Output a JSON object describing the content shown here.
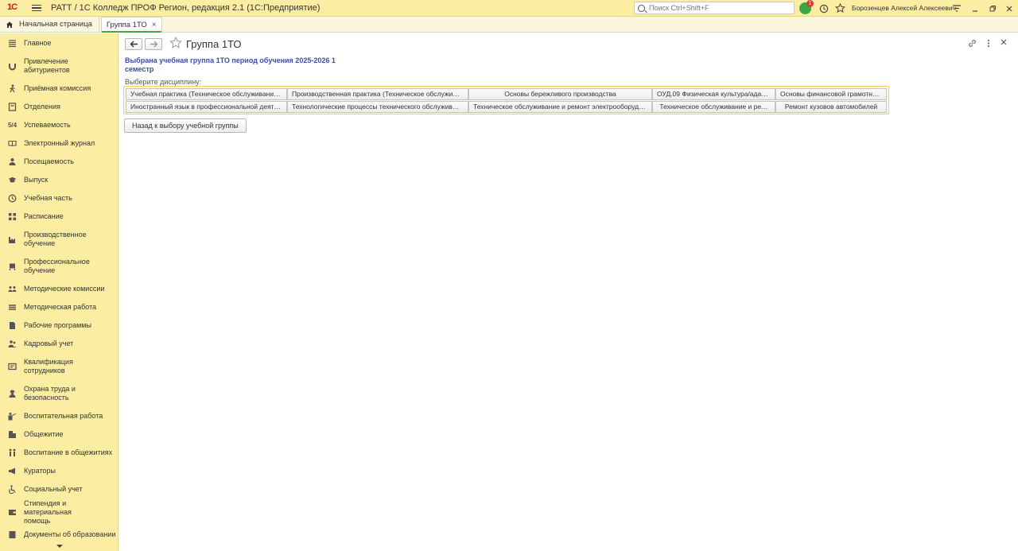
{
  "app": {
    "title": "РАТТ / 1С Колледж ПРОФ Регион, редакция 2.1  (1С:Предприятие)",
    "search_placeholder": "Поиск Ctrl+Shift+F",
    "notifications_count": "1",
    "user_name": "Борозенцев Алексей Алексеевич"
  },
  "tabs": {
    "home": "Начальная страница",
    "active": "Группа 1ТО"
  },
  "sidebar": {
    "items": [
      {
        "label": "Главное",
        "icon": "menu-icon"
      },
      {
        "label": "Привлечение абитуриентов",
        "icon": "magnet-icon"
      },
      {
        "label": "Приёмная комиссия",
        "icon": "walking-person-icon"
      },
      {
        "label": "Отделения",
        "icon": "document-icon"
      },
      {
        "label": "Успеваемость",
        "icon": "grades-icon"
      },
      {
        "label": "Электронный журнал",
        "icon": "book-icon"
      },
      {
        "label": "Посещаемость",
        "icon": "person-icon"
      },
      {
        "label": "Выпуск",
        "icon": "graduation-cap-icon"
      },
      {
        "label": "Учебная часть",
        "icon": "clock-icon"
      },
      {
        "label": "Расписание",
        "icon": "schedule-icon"
      },
      {
        "label": "Производственное обучение",
        "icon": "factory-icon"
      },
      {
        "label": "Профессиональное обучение",
        "icon": "machine-icon"
      },
      {
        "label": "Методические комиссии",
        "icon": "group-icon"
      },
      {
        "label": "Методическая работа",
        "icon": "stack-icon"
      },
      {
        "label": "Рабочие программы",
        "icon": "file-icon"
      },
      {
        "label": "Кадровый учет",
        "icon": "people-icon"
      },
      {
        "label": "Квалификация сотрудников",
        "icon": "certificate-icon"
      },
      {
        "label": "Охрана труда и безопасность",
        "icon": "worker-icon"
      },
      {
        "label": "Воспитательная работа",
        "icon": "teacher-icon"
      },
      {
        "label": "Общежитие",
        "icon": "building-icon"
      },
      {
        "label": "Воспитание в общежитиях",
        "icon": "couple-icon"
      },
      {
        "label": "Кураторы",
        "icon": "megaphone-icon"
      },
      {
        "label": "Социальный учет",
        "icon": "wheelchair-icon"
      },
      {
        "label": "Стипендия и материальная помощь",
        "icon": "wallet-icon"
      },
      {
        "label": "Документы об образовании",
        "icon": "diploma-icon"
      }
    ]
  },
  "page": {
    "title": "Группа 1ТО",
    "heading_line1": "Выбрана учебная группа 1ТО период обучения 2025-2026 1",
    "heading_line2": "семестр",
    "caption": "Выберите дисциплину:",
    "disciplines_row1": [
      "Учебная практика (Техническое обслуживани…",
      "Производственная практика (Техническое обслужи…",
      "Основы бережливого производства",
      "ОУД.09 Физическая культура/ада…",
      "Основы финансовой грамотно…"
    ],
    "disciplines_row2": [
      "Иностранный язык в профессиональной деят…",
      "Технологические процессы технического обслужив…",
      "Техническое обслуживание и ремонт электрооборуд…",
      "Техническое обслуживание и ре…",
      "Ремонт кузовов автомобилей"
    ],
    "back_button": "Назад к выбору учебной группы"
  }
}
